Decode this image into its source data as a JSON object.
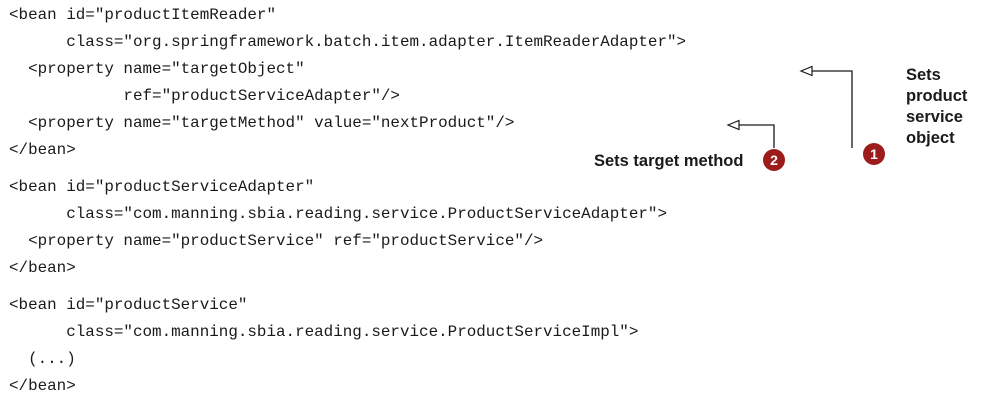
{
  "code_lines": [
    "<bean id=\"productItemReader\"",
    "      class=\"org.springframework.batch.item.adapter.ItemReaderAdapter\">",
    "  <property name=\"targetObject\"",
    "            ref=\"productServiceAdapter\"/>",
    "  <property name=\"targetMethod\" value=\"nextProduct\"/>",
    "</bean>",
    "<bean id=\"productServiceAdapter\"",
    "      class=\"com.manning.sbia.reading.service.ProductServiceAdapter\">",
    "  <property name=\"productService\" ref=\"productService\"/>",
    "</bean>",
    "<bean id=\"productService\"",
    "      class=\"com.manning.sbia.reading.service.ProductServiceImpl\">",
    "  (...)",
    "</bean>"
  ],
  "annotations": {
    "callout1": {
      "number": "1",
      "text_lines": [
        "Sets",
        "product",
        "service",
        "object"
      ]
    },
    "callout2": {
      "number": "2",
      "text": "Sets target method"
    }
  },
  "colors": {
    "callout": "#9c1c1c",
    "text": "#1a1a1a",
    "background": "#ffffff"
  }
}
